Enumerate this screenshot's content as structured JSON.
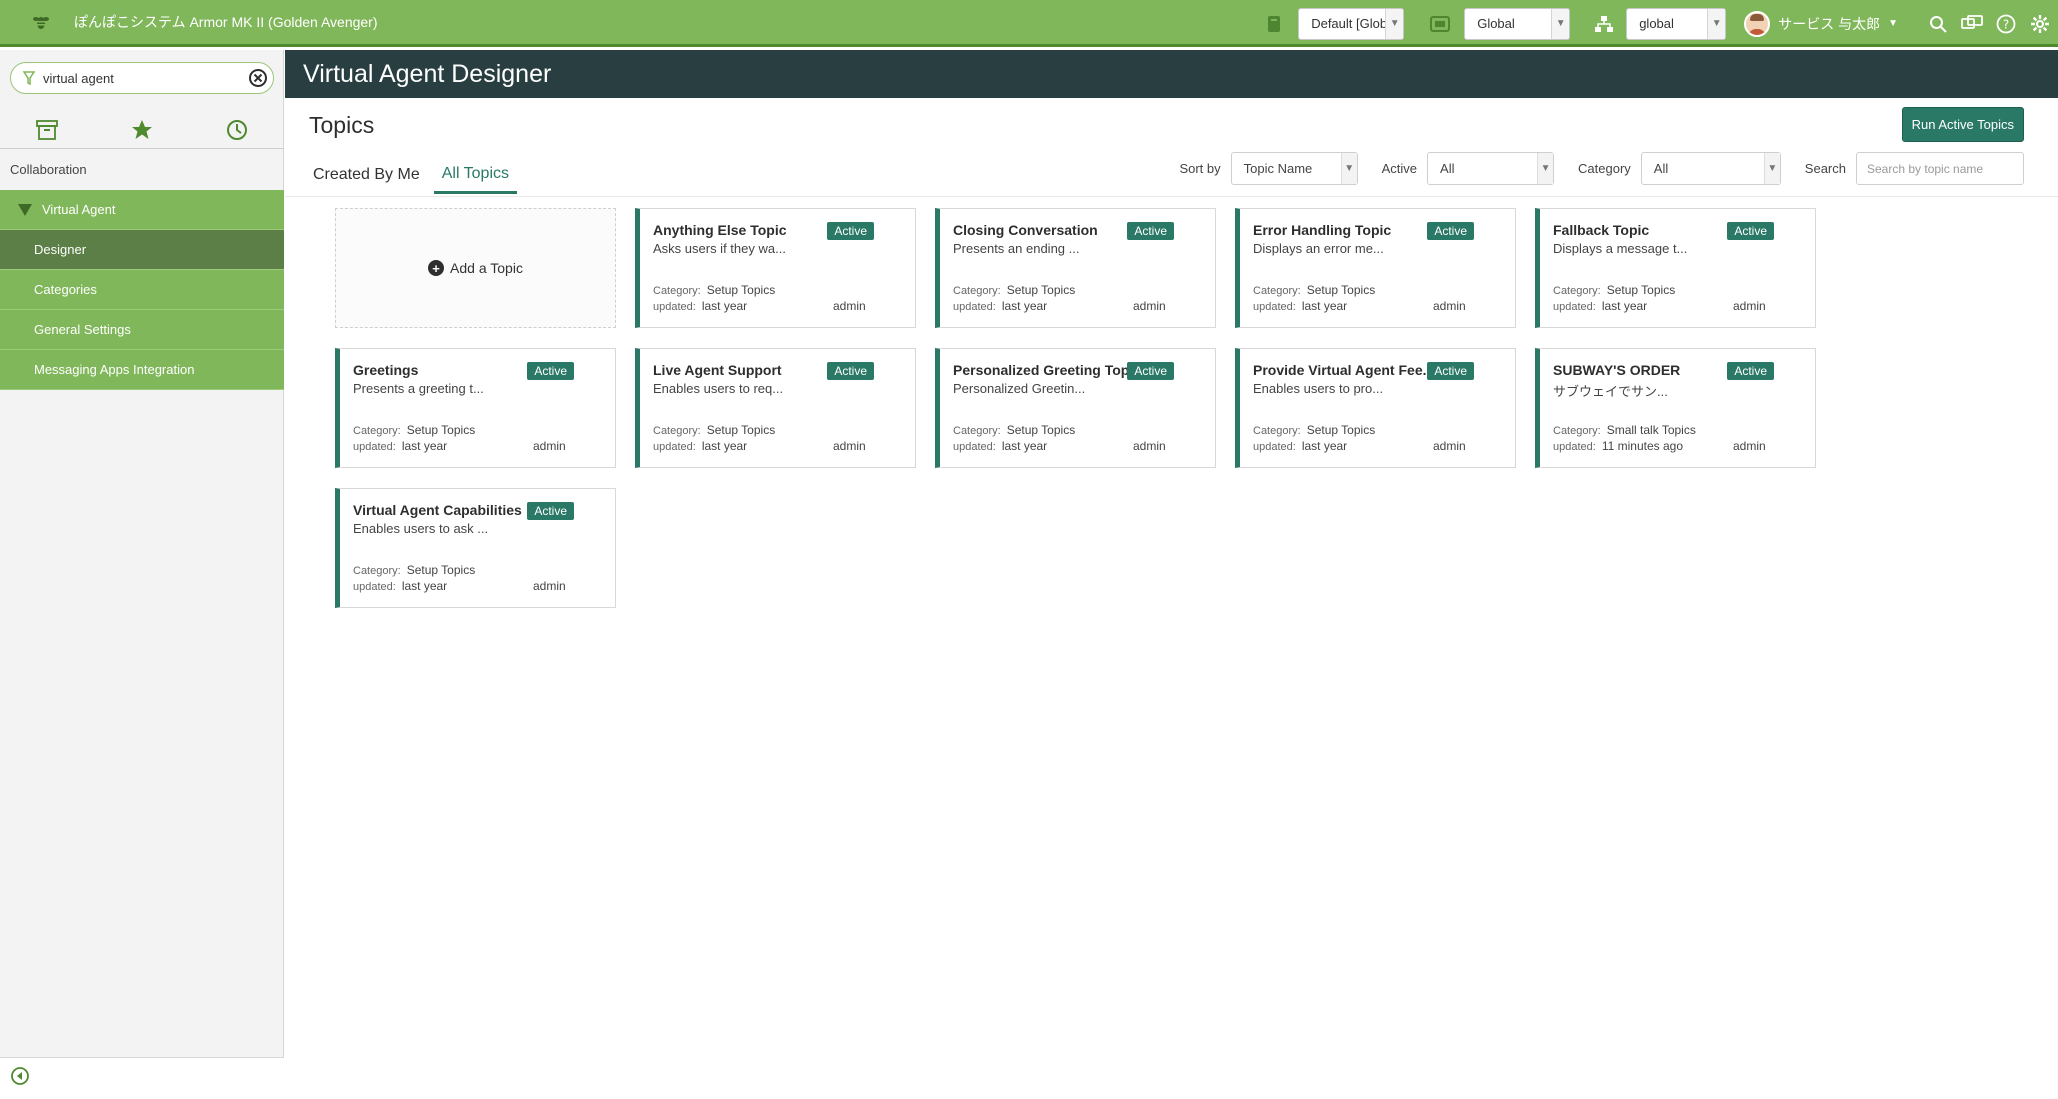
{
  "banner": {
    "app_name": "ぽんぽこシステム Armor MK II (Golden Avenger)",
    "update_set": "Default [Glob",
    "application": "Global",
    "domain": "global",
    "user_name": "サービス 与太郎"
  },
  "nav": {
    "filter_value": "virtual agent",
    "app_group": "Collaboration",
    "modules": [
      {
        "label": "Virtual Agent"
      },
      {
        "label": "Designer"
      },
      {
        "label": "Categories"
      },
      {
        "label": "General Settings"
      },
      {
        "label": "Messaging Apps Integration"
      }
    ]
  },
  "main": {
    "header_title": "Virtual Agent Designer",
    "section_title": "Topics",
    "run_button": "Run Active Topics",
    "tabs": [
      {
        "label": "Created By Me"
      },
      {
        "label": "All Topics"
      }
    ],
    "sort_label": "Sort by",
    "sort_value": "Topic Name",
    "active_label": "Active",
    "active_value": "All",
    "category_label": "Category",
    "category_value": "All",
    "search_label": "Search",
    "search_placeholder": "Search by topic name",
    "add_topic": "Add a Topic",
    "category_key": "Category:",
    "updated_key": "updated:"
  },
  "topics": [
    {
      "title": "Anything Else Topic",
      "status": "Active",
      "desc": "Asks users if they wa...",
      "category": "Setup Topics",
      "updated": "last year",
      "by": "admin"
    },
    {
      "title": "Closing Conversation",
      "status": "Active",
      "desc": "Presents an ending ...",
      "category": "Setup Topics",
      "updated": "last year",
      "by": "admin"
    },
    {
      "title": "Error Handling Topic",
      "status": "Active",
      "desc": "Displays an error me...",
      "category": "Setup Topics",
      "updated": "last year",
      "by": "admin"
    },
    {
      "title": "Fallback Topic",
      "status": "Active",
      "desc": "Displays a message t...",
      "category": "Setup Topics",
      "updated": "last year",
      "by": "admin"
    },
    {
      "title": "Greetings",
      "status": "Active",
      "desc": "Presents a greeting t...",
      "category": "Setup Topics",
      "updated": "last year",
      "by": "admin"
    },
    {
      "title": "Live Agent Support",
      "status": "Active",
      "desc": "Enables users to req...",
      "category": "Setup Topics",
      "updated": "last year",
      "by": "admin"
    },
    {
      "title": "Personalized Greeting Topic",
      "status": "Active",
      "desc": "Personalized Greetin...",
      "category": "Setup Topics",
      "updated": "last year",
      "by": "admin"
    },
    {
      "title": "Provide Virtual Agent Fee...",
      "status": "Active",
      "desc": "Enables users to pro...",
      "category": "Setup Topics",
      "updated": "last year",
      "by": "admin"
    },
    {
      "title": "SUBWAY'S ORDER",
      "status": "Active",
      "desc": "サブウェイでサン...",
      "category": "Small talk Topics",
      "updated": "11 minutes ago",
      "by": "admin"
    },
    {
      "title": "Virtual Agent Capabilities",
      "status": "Active",
      "desc": "Enables users to ask ...",
      "category": "Setup Topics",
      "updated": "last year",
      "by": "admin"
    }
  ],
  "icons": {
    "logo": "bee-logo-icon",
    "update_set": "update-set-icon",
    "application": "application-picker-icon",
    "domain": "domain-tree-icon",
    "search": "search-icon",
    "chat": "connect-chat-icon",
    "help": "help-icon",
    "settings": "gear-icon"
  },
  "colors": {
    "banner": "#81b75b",
    "header": "#293e40",
    "accent": "#2a7967"
  }
}
